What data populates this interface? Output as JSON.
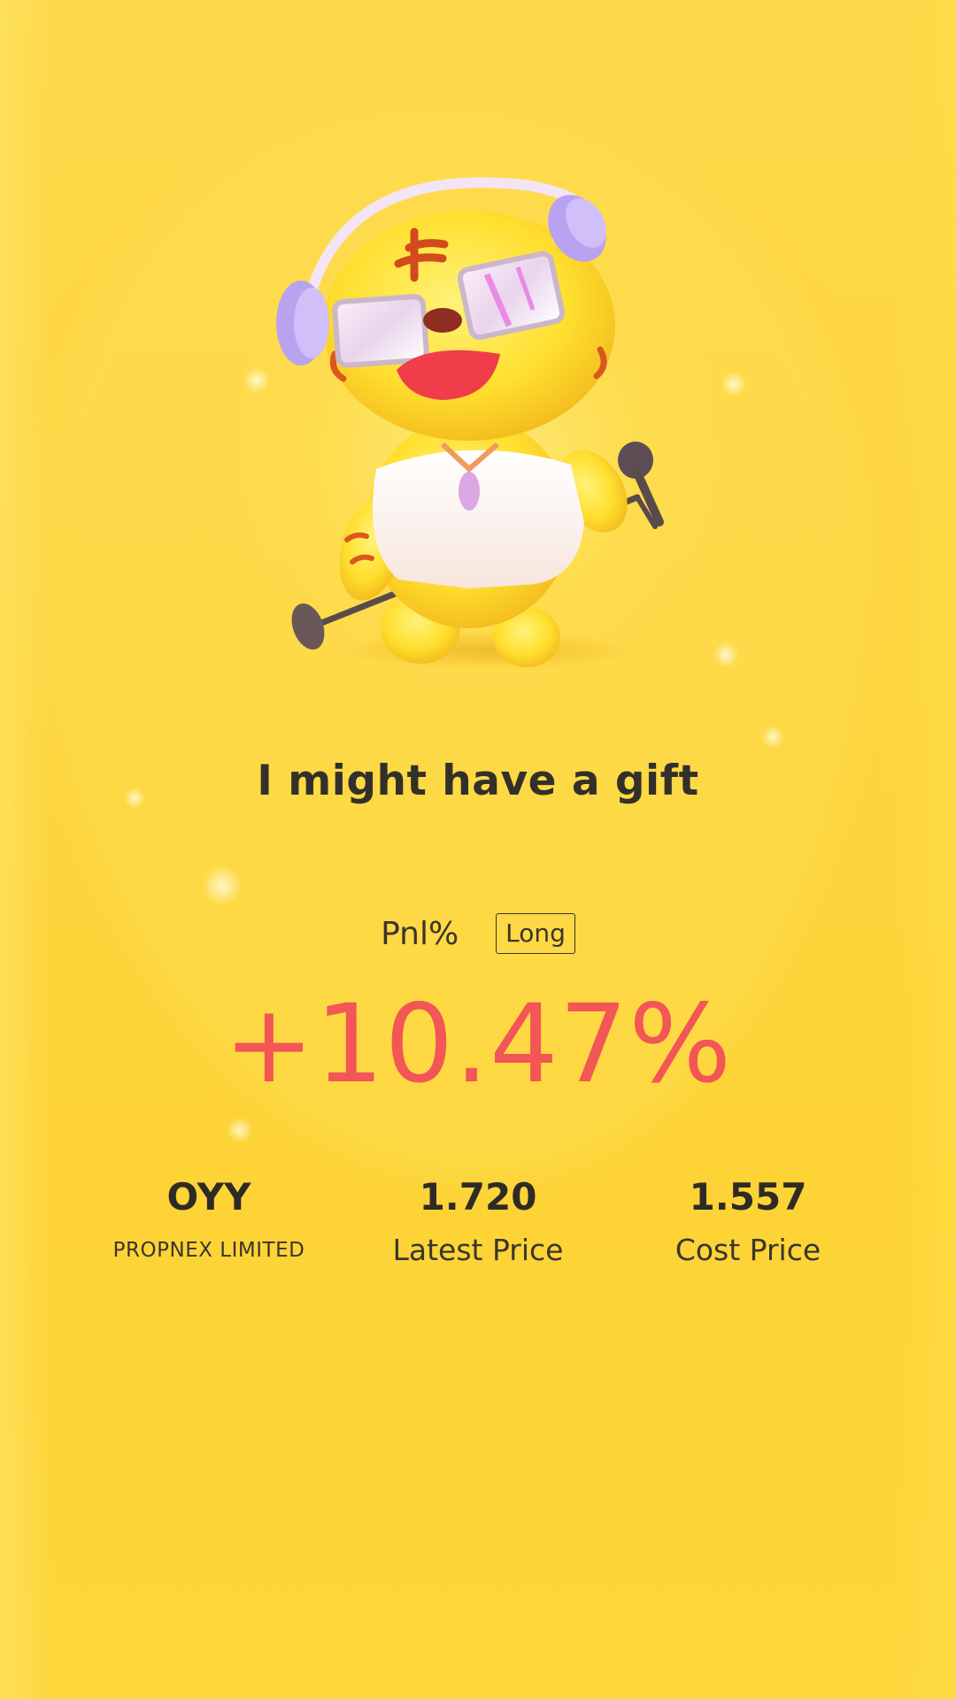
{
  "headline": "I might have a gift",
  "pnl": {
    "label": "Pnl%",
    "direction": "Long",
    "value": "+10.47%"
  },
  "stock": {
    "ticker": "OYY",
    "name": "PROPNEX LIMITED"
  },
  "latest_price": {
    "value": "1.720",
    "label": "Latest Price"
  },
  "cost_price": {
    "value": "1.557",
    "label": "Cost Price"
  },
  "colors": {
    "background": "#fdd43a",
    "gain": "#f25656",
    "text": "#33302a"
  },
  "mascot": {
    "icon": "tiger-mascot-singing-icon"
  }
}
